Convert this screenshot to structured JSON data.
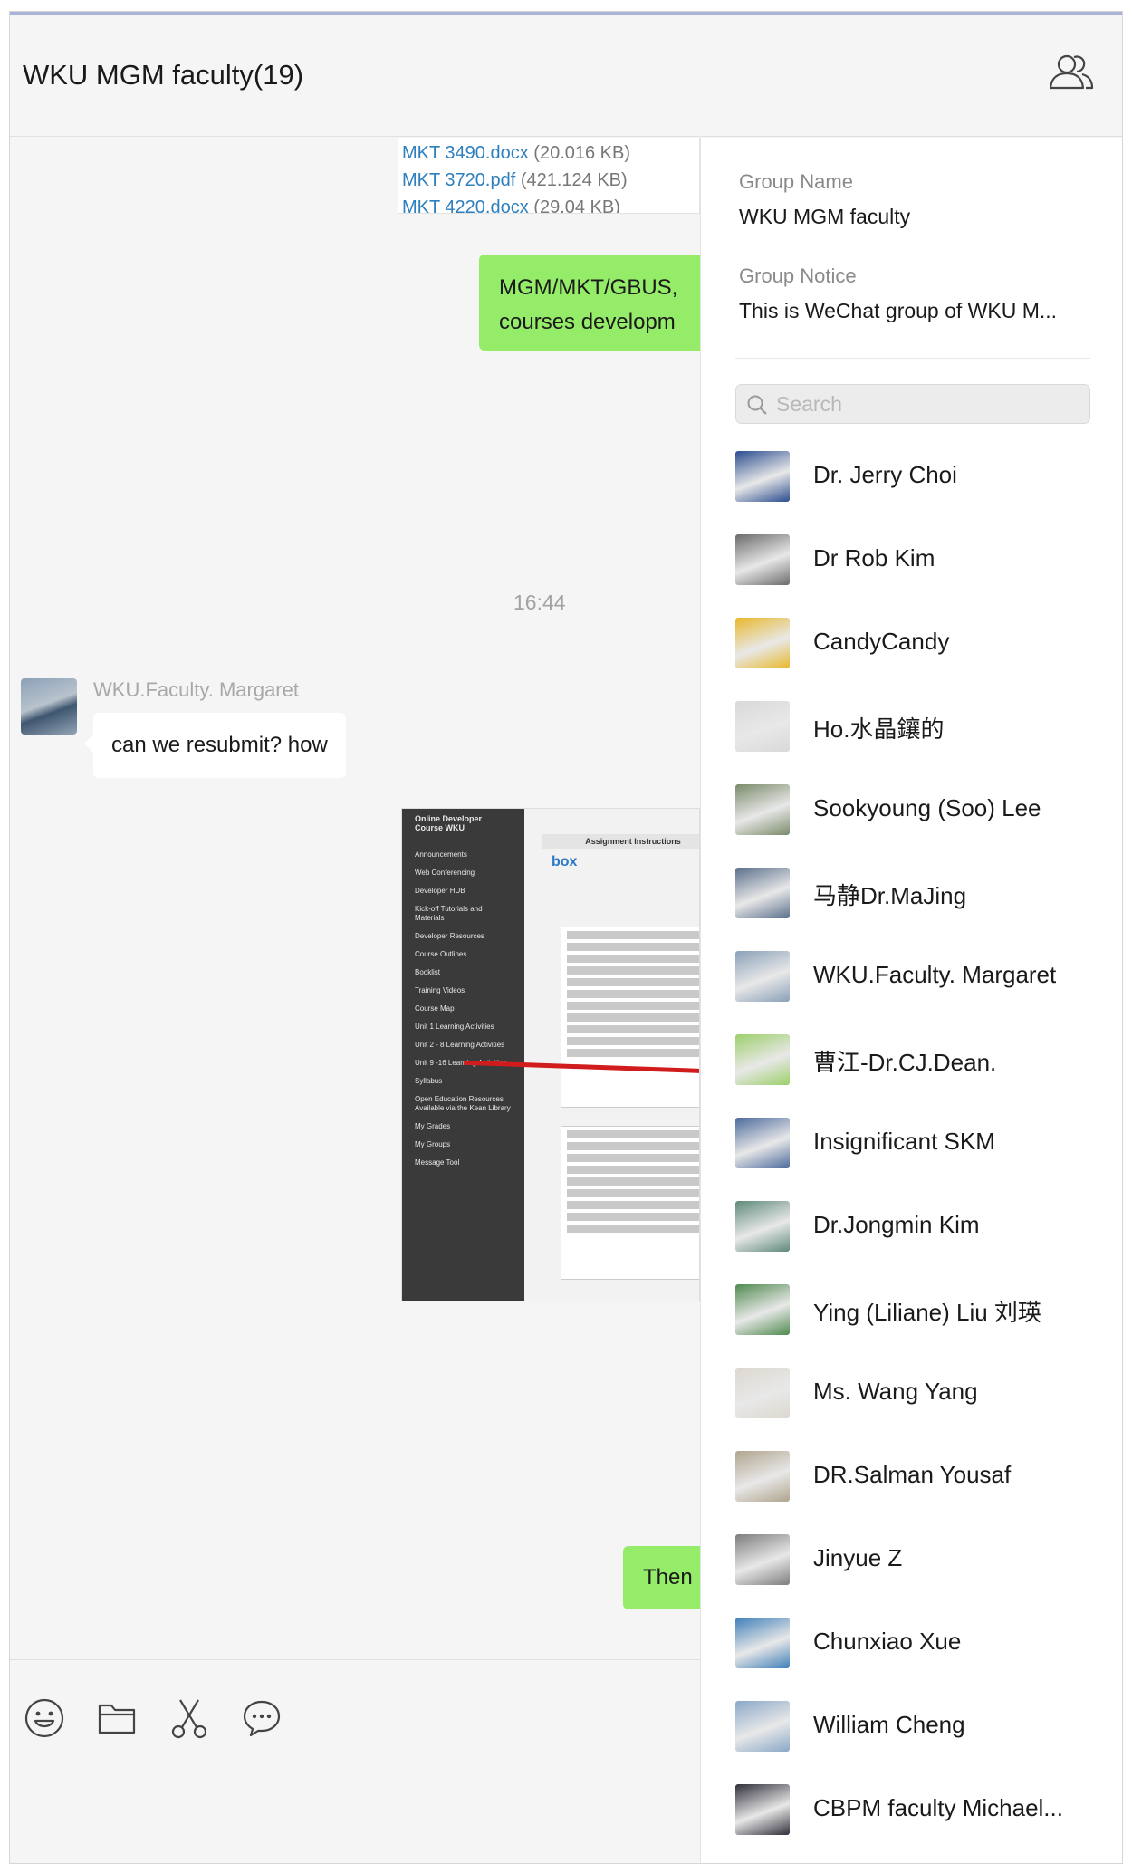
{
  "header": {
    "title": "WKU MGM faculty(19)"
  },
  "colors": {
    "sent_bubble": "#95ec69",
    "link": "#2d7fbd",
    "panel_bg": "#ffffff",
    "chat_bg": "#f5f5f5"
  },
  "chat": {
    "files": [
      {
        "name": "MKT 3490.docx",
        "size": "(20.016 KB)"
      },
      {
        "name": "MKT 3720.pdf",
        "size": "(421.124 KB)"
      },
      {
        "name": "MKT 4220.docx",
        "size": "(29.04 KB)"
      }
    ],
    "sent_message_1": {
      "line1": "MGM/MKT/GBUS,",
      "line2": "courses developm"
    },
    "timestamp": "16:44",
    "incoming": {
      "sender": "WKU.Faculty. Margaret",
      "text": "can we resubmit? how"
    },
    "screenshot": {
      "course_title": "Online Developer Course WKU",
      "sidebar_items": [
        "Announcements",
        "Web Conferencing",
        "Developer HUB",
        "Kick-off Tutorials and Materials",
        "Developer Resources",
        "Course Outlines",
        "Booklist",
        "Training Videos",
        "Course Map",
        "Unit 1 Learning Activities",
        "Unit 2 - 8 Learning Activities",
        "Unit 9 -16 Learning Activities",
        "Syllabus",
        "Open Education Resources Available via the Kean Library",
        "My Grades",
        "My Groups",
        "Message Tool"
      ],
      "header": "Assignment Instructions",
      "box_logo": "box"
    },
    "sent_message_2": "Then"
  },
  "toolbar": {
    "icons": [
      "emoji-icon",
      "folder-icon",
      "scissors-icon",
      "chat-bubble-icon"
    ]
  },
  "panel": {
    "group_name_label": "Group Name",
    "group_name": "WKU MGM faculty",
    "group_notice_label": "Group Notice",
    "group_notice": "This is WeChat group of WKU M...",
    "search_placeholder": "Search",
    "members": [
      {
        "name": "Dr. Jerry Choi",
        "color": "#2b4d8f"
      },
      {
        "name": "Dr Rob Kim",
        "color": "#6b6b6b"
      },
      {
        "name": "CandyCandy",
        "color": "#e8b82a"
      },
      {
        "name": "Ho.水晶鑲的",
        "color": "#d9d9d9"
      },
      {
        "name": "Sookyoung (Soo) Lee",
        "color": "#7a8a6a"
      },
      {
        "name": "马静Dr.MaJing",
        "color": "#5a6f8a"
      },
      {
        "name": "WKU.Faculty. Margaret",
        "color": "#8aa0b8"
      },
      {
        "name": "曹江-Dr.CJ.Dean.",
        "color": "#9ccf6a"
      },
      {
        "name": "Insignificant SKM",
        "color": "#4b6a9c"
      },
      {
        "name": "Dr.Jongmin Kim",
        "color": "#5f8a7a"
      },
      {
        "name": "Ying (Liliane) Liu 刘瑛",
        "color": "#4f8a4f"
      },
      {
        "name": "Ms. Wang Yang",
        "color": "#dcd8cf"
      },
      {
        "name": "DR.Salman Yousaf",
        "color": "#b0a48e"
      },
      {
        "name": "Jinyue Z",
        "color": "#7d7d7d"
      },
      {
        "name": "Chunxiao Xue",
        "color": "#3f7fb8"
      },
      {
        "name": "William Cheng",
        "color": "#8aa8c8"
      },
      {
        "name": "CBPM faculty Michael...",
        "color": "#2f2f3a"
      }
    ]
  }
}
